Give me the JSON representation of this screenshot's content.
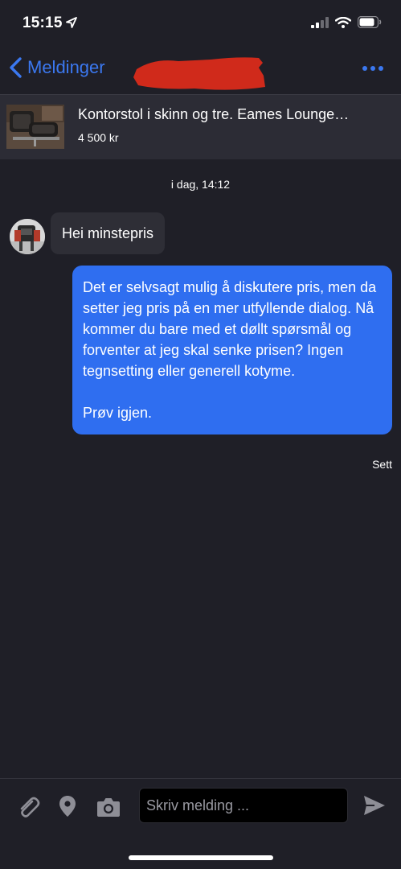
{
  "status_bar": {
    "time": "15:15"
  },
  "nav": {
    "back_label": "Meldinger"
  },
  "listing": {
    "title": "Kontorstol i skinn og tre. Eames Lounge…",
    "price": "4 500 kr"
  },
  "conversation": {
    "timestamp": "i dag, 14:12",
    "incoming": {
      "text": "Hei minstepris"
    },
    "outgoing": {
      "text": "Det er selvsagt mulig å diskutere pris, men da setter jeg pris på en mer utfyllende dialog. Nå kommer du bare med et døllt spørsmål og forventer at jeg skal senke prisen? Ingen tegnsetting eller generell kotyme.\n\nPrøv igjen.",
      "status": "Sett"
    }
  },
  "composer": {
    "placeholder": "Skriv melding ..."
  },
  "colors": {
    "accent": "#3b78f0",
    "outgoing_bubble": "#2f6ef0",
    "background": "#1f1f27"
  }
}
